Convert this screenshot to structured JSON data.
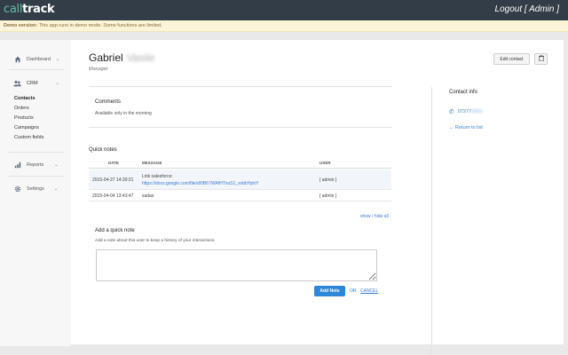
{
  "header": {
    "logo_part1": "call",
    "logo_part2": "track",
    "logout_label": "Logout [ Admin ]"
  },
  "demo_banner": {
    "label": "Demo version:",
    "message": "This app runs in demo mode. Some functions are limited."
  },
  "sidebar": {
    "dashboard_label": "Dashboard",
    "crm_label": "CRM",
    "crm_items": [
      {
        "label": "Contacts",
        "active": true
      },
      {
        "label": "Orders",
        "active": false
      },
      {
        "label": "Products",
        "active": false
      },
      {
        "label": "Campaigns",
        "active": false
      },
      {
        "label": "Custom fields",
        "active": false
      }
    ],
    "reports_label": "Reports",
    "settings_label": "Settings"
  },
  "contact": {
    "first_name": "Gabriel",
    "last_name_blurred": "Vasile",
    "role": "Manager",
    "edit_button": "Edit contact"
  },
  "comments": {
    "title": "Comments",
    "text": "Available only in the morning"
  },
  "quick_notes": {
    "title": "Quick notes",
    "columns": [
      "DATE",
      "MESSAGE",
      "USER"
    ],
    "rows": [
      {
        "date": "2015-04-27 14:39:21",
        "message_line1": "Link salesforce:",
        "message_link": "https://docs.google.com/file/d/0B67WAfHTnuS1_xvbbYplxY",
        "user": "[ admin ]"
      },
      {
        "date": "2015-04-04 13:43:47",
        "message_line1": "sadas",
        "message_link": "",
        "user": "[ admin ]"
      }
    ],
    "show_hide": "show / hide all"
  },
  "add_note": {
    "title": "Add a quick note",
    "description": "Add a note about this user to keep a history of your interactions.",
    "value": "",
    "button": "Add Note",
    "or": "OR",
    "cancel": "CANCEL"
  },
  "contact_info": {
    "title": "Contact info",
    "phone_visible": "07277",
    "phone_blurred": "4855",
    "return_link": "← Return to list"
  },
  "colors": {
    "topbar": "#333d47",
    "accent_blue": "#2d87d6",
    "logo_green": "#5bc0a6",
    "banner_bg": "#fbf4d8"
  }
}
